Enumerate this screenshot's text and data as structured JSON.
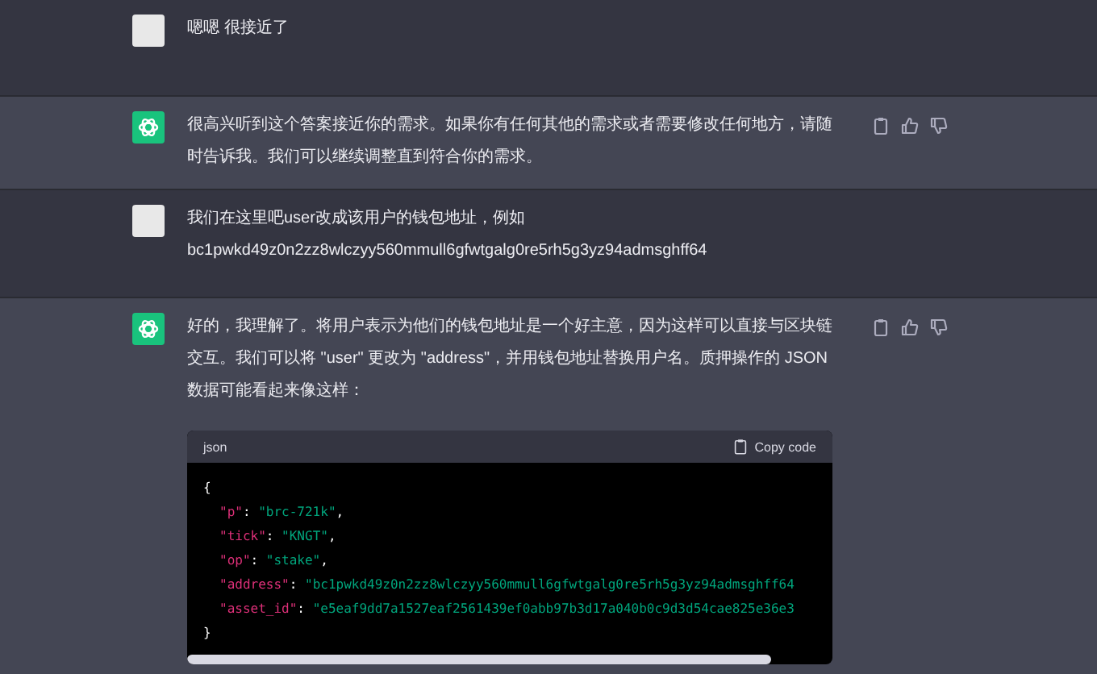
{
  "messages": [
    {
      "kind": "user",
      "text": "嗯嗯 很接近了"
    },
    {
      "kind": "assistant",
      "text": "很高兴听到这个答案接近你的需求。如果你有任何其他的需求或者需要修改任何地方，请随时告诉我。我们可以继续调整直到符合你的需求。"
    },
    {
      "kind": "user",
      "text": "我们在这里吧user改成该用户的钱包地址，例如 bc1pwkd49z0n2zz8wlczyy560mmull6gfwtgalg0re5rh5g3yz94admsghff64"
    },
    {
      "kind": "assistant",
      "text": "好的，我理解了。将用户表示为他们的钱包地址是一个好主意，因为这样可以直接与区块链交互。我们可以将 \"user\" 更改为 \"address\"，并用钱包地址替换用户名。质押操作的 JSON 数据可能看起来像这样：",
      "code": {
        "language": "json",
        "copy_label": "Copy code",
        "lines": [
          {
            "indent": false,
            "tokens": [
              {
                "kind": "punct",
                "text": "{"
              }
            ]
          },
          {
            "indent": true,
            "tokens": [
              {
                "kind": "key",
                "text": "\"p\""
              },
              {
                "kind": "punct",
                "text": ": "
              },
              {
                "kind": "string",
                "text": "\"brc-721k\""
              },
              {
                "kind": "punct",
                "text": ","
              }
            ]
          },
          {
            "indent": true,
            "tokens": [
              {
                "kind": "key",
                "text": "\"tick\""
              },
              {
                "kind": "punct",
                "text": ": "
              },
              {
                "kind": "string",
                "text": "\"KNGT\""
              },
              {
                "kind": "punct",
                "text": ","
              }
            ]
          },
          {
            "indent": true,
            "tokens": [
              {
                "kind": "key",
                "text": "\"op\""
              },
              {
                "kind": "punct",
                "text": ": "
              },
              {
                "kind": "string",
                "text": "\"stake\""
              },
              {
                "kind": "punct",
                "text": ","
              }
            ]
          },
          {
            "indent": true,
            "tokens": [
              {
                "kind": "key",
                "text": "\"address\""
              },
              {
                "kind": "punct",
                "text": ": "
              },
              {
                "kind": "string",
                "text": "\"bc1pwkd49z0n2zz8wlczyy560mmull6gfwtgalg0re5rh5g3yz94admsghff64"
              }
            ]
          },
          {
            "indent": true,
            "tokens": [
              {
                "kind": "key",
                "text": "\"asset_id\""
              },
              {
                "kind": "punct",
                "text": ": "
              },
              {
                "kind": "string",
                "text": "\"e5eaf9dd7a1527eaf2561439ef0abb97b3d17a040b0c9d3d54cae825e36e3"
              }
            ]
          },
          {
            "indent": false,
            "tokens": [
              {
                "kind": "punct",
                "text": "}"
              }
            ]
          }
        ]
      }
    }
  ]
}
